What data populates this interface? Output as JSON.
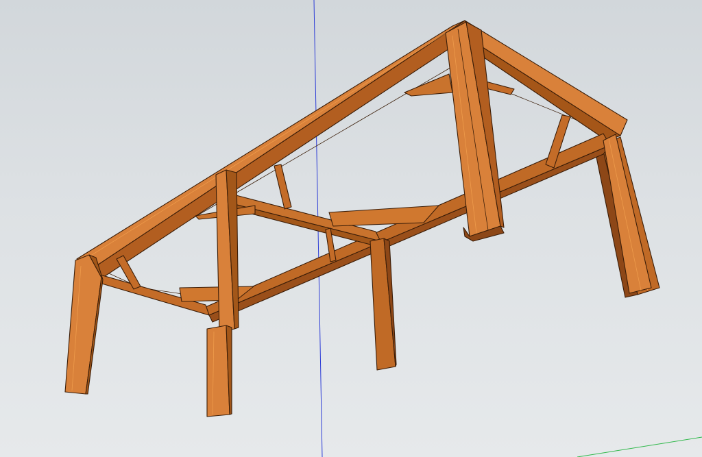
{
  "viewport": {
    "background_top": "#d2d7db",
    "background_bottom": "#e6e9eb"
  },
  "axes": {
    "blue_axis_color": "#2b3bd6",
    "green_axis_color": "#2fb84a"
  },
  "model": {
    "wood_light": "#d9813a",
    "wood_mid": "#c06a26",
    "wood_dark": "#8d4717",
    "tabletop_color": "#cfa868",
    "outline_color": "#3a1d08"
  }
}
